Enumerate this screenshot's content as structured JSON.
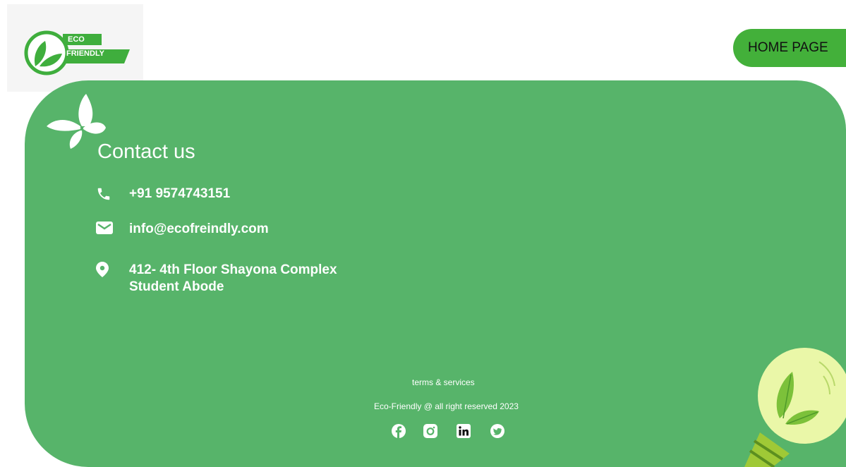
{
  "header": {
    "logo": {
      "line1": "ECO",
      "line2": "FRIENDLY"
    },
    "home_button": "HOME PAGE"
  },
  "contact": {
    "title": "Contact us",
    "phone": "+91 9574743151",
    "email": "info@ecofreindly.com",
    "address_line1": "412- 4th Floor Shayona Complex",
    "address_line2": "Student Abode"
  },
  "footer": {
    "terms": "terms & services",
    "copyright": "Eco-Friendly @ all right reserved 2023",
    "social": [
      "facebook-icon",
      "instagram-icon",
      "linkedin-icon",
      "twitter-icon"
    ]
  },
  "colors": {
    "panel": "#57b46a",
    "button": "#43b03a",
    "logo_green": "#3fae3d",
    "bulb_glow": "#eaf7a8"
  }
}
